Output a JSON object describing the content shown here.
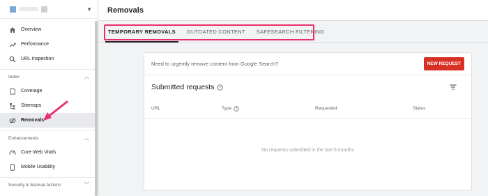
{
  "header": {
    "title": "Removals"
  },
  "sidebar": {
    "property_selector": {
      "squares": [
        "#7aaad6",
        "#d0d0d0"
      ]
    },
    "top_items": [
      {
        "label": "Overview",
        "icon": "home-icon"
      },
      {
        "label": "Performance",
        "icon": "trend-icon"
      },
      {
        "label": "URL inspection",
        "icon": "search-icon"
      }
    ],
    "sections": [
      {
        "label": "Index",
        "items": [
          {
            "label": "Coverage",
            "icon": "file-icon"
          },
          {
            "label": "Sitemaps",
            "icon": "sitemap-icon"
          },
          {
            "label": "Removals",
            "icon": "eye-off-icon",
            "active": true
          }
        ]
      },
      {
        "label": "Enhancements",
        "items": [
          {
            "label": "Core Web Vitals",
            "icon": "gauge-icon"
          },
          {
            "label": "Mobile Usability",
            "icon": "phone-icon"
          }
        ]
      },
      {
        "label": "Security & Manual Actions",
        "items": []
      }
    ]
  },
  "tabs": [
    {
      "label": "TEMPORARY REMOVALS",
      "active": true
    },
    {
      "label": "OUTDATED CONTENT",
      "active": false
    },
    {
      "label": "SAFESEARCH FILTERING",
      "active": false
    }
  ],
  "card": {
    "prompt": "Need to urgently remove content from Google Search?",
    "new_request_label": "NEW REQUEST",
    "subtitle": "Submitted requests",
    "columns": [
      "URL",
      "Type",
      "Requested",
      "Status"
    ],
    "empty_message": "No requests submitted in the last 6 months"
  },
  "colors": {
    "accent": "#d93025",
    "highlight": "#e8316a"
  }
}
